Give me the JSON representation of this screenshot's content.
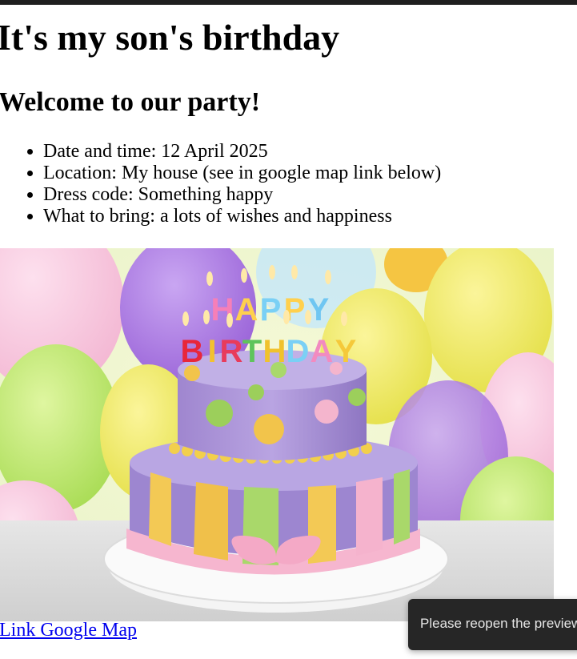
{
  "page": {
    "title": "It's my son's birthday",
    "subtitle": "Welcome to our party!",
    "details": [
      "Date and time: 12 April 2025",
      "Location: My house (see in google map link below)",
      "Dress code: Something happy",
      "What to bring: a lots of wishes and happiness"
    ],
    "cake_candle_text": "HAPPY BIRTHDAY",
    "map_link_label": "Link Google Map"
  },
  "toast": {
    "message": "Please reopen the preview"
  },
  "colors": {
    "link": "#0000ee",
    "toast_bg": "#262626",
    "topbar": "#1f1f1f"
  }
}
